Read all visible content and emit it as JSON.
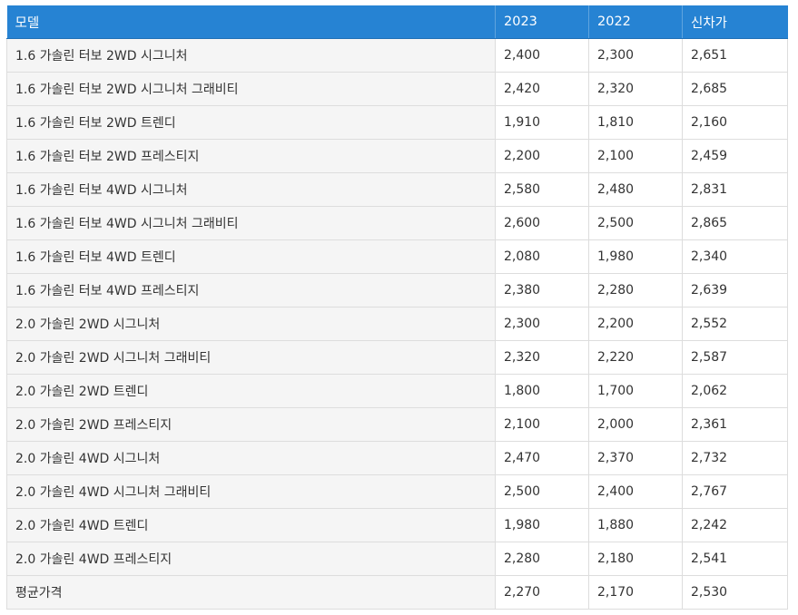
{
  "header": {
    "model": "모델",
    "y2023": "2023",
    "y2022": "2022",
    "new_price": "신차가"
  },
  "rows": [
    {
      "model": "1.6 가솔린 터보 2WD 시그니처",
      "y2023": "2,400",
      "y2022": "2,300",
      "new_price": "2,651"
    },
    {
      "model": "1.6 가솔린 터보 2WD 시그니처 그래비티",
      "y2023": "2,420",
      "y2022": "2,320",
      "new_price": "2,685"
    },
    {
      "model": "1.6 가솔린 터보 2WD 트렌디",
      "y2023": "1,910",
      "y2022": "1,810",
      "new_price": "2,160"
    },
    {
      "model": "1.6 가솔린 터보 2WD 프레스티지",
      "y2023": "2,200",
      "y2022": "2,100",
      "new_price": "2,459"
    },
    {
      "model": "1.6 가솔린 터보 4WD 시그니처",
      "y2023": "2,580",
      "y2022": "2,480",
      "new_price": "2,831"
    },
    {
      "model": "1.6 가솔린 터보 4WD 시그니처 그래비티",
      "y2023": "2,600",
      "y2022": "2,500",
      "new_price": "2,865"
    },
    {
      "model": "1.6 가솔린 터보 4WD 트렌디",
      "y2023": "2,080",
      "y2022": "1,980",
      "new_price": "2,340"
    },
    {
      "model": "1.6 가솔린 터보 4WD 프레스티지",
      "y2023": "2,380",
      "y2022": "2,280",
      "new_price": "2,639"
    },
    {
      "model": "2.0 가솔린 2WD 시그니처",
      "y2023": "2,300",
      "y2022": "2,200",
      "new_price": "2,552"
    },
    {
      "model": "2.0 가솔린 2WD 시그니처 그래비티",
      "y2023": "2,320",
      "y2022": "2,220",
      "new_price": "2,587"
    },
    {
      "model": "2.0 가솔린 2WD 트렌디",
      "y2023": "1,800",
      "y2022": "1,700",
      "new_price": "2,062"
    },
    {
      "model": "2.0 가솔린 2WD 프레스티지",
      "y2023": "2,100",
      "y2022": "2,000",
      "new_price": "2,361"
    },
    {
      "model": "2.0 가솔린 4WD 시그니처",
      "y2023": "2,470",
      "y2022": "2,370",
      "new_price": "2,732"
    },
    {
      "model": "2.0 가솔린 4WD 시그니처 그래비티",
      "y2023": "2,500",
      "y2022": "2,400",
      "new_price": "2,767"
    },
    {
      "model": "2.0 가솔린 4WD 트렌디",
      "y2023": "1,980",
      "y2022": "1,880",
      "new_price": "2,242"
    },
    {
      "model": "2.0 가솔린 4WD 프레스티지",
      "y2023": "2,280",
      "y2022": "2,180",
      "new_price": "2,541"
    }
  ],
  "average": {
    "model": "평균가격",
    "y2023": "2,270",
    "y2022": "2,170",
    "new_price": "2,530"
  },
  "colors": {
    "header_bg": "#2683d3",
    "header_text": "#ffffff",
    "first_col_bg": "#f5f5f5",
    "border": "#dddddd"
  }
}
